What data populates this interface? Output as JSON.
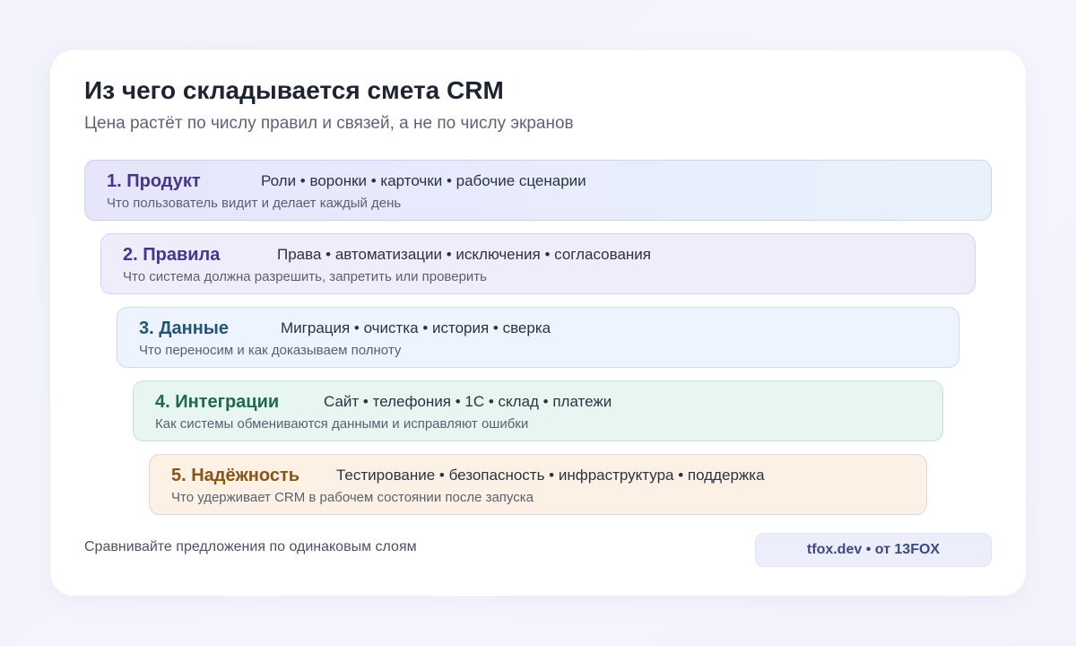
{
  "title": "Из чего складывается смета CRM",
  "subtitle": "Цена растёт по числу правил и связей, а не по числу экранов",
  "layers": [
    {
      "heading": "1. Продукт",
      "items": "Роли • воронки • карточки • рабочие сценарии",
      "description": "Что пользователь видит и делает каждый день",
      "heading_color": "#46348f",
      "background": "linear-gradient(90deg, #e6e5fb 0%, #e9f2fc 100%)"
    },
    {
      "heading": "2. Правила",
      "items": "Права • автоматизации • исключения • согласования",
      "description": "Что система должна разрешить, запретить или проверить",
      "heading_color": "#46348f",
      "background": "#efedfc"
    },
    {
      "heading": "3. Данные",
      "items": "Миграция • очистка • история • сверка",
      "description": "Что переносим и как доказываем полноту",
      "heading_color": "#235479",
      "background": "#edf4fd"
    },
    {
      "heading": "4. Интеграции",
      "items": "Сайт • телефония • 1С • склад • платежи",
      "description": "Как системы обмениваются данными и исправляют ошибки",
      "heading_color": "#1d6a4e",
      "background": "#e8f6f1"
    },
    {
      "heading": "5. Надёжность",
      "items": "Тестирование • безопасность • инфраструктура • поддержка",
      "description": "Что удерживает CRM в рабочем состоянии после запуска",
      "heading_color": "#8a5317",
      "background": "#fdf1e5"
    }
  ],
  "footer": {
    "note": "Сравнивайте предложения по одинаковым слоям",
    "brand": "tfox.dev • от 13FOX"
  }
}
